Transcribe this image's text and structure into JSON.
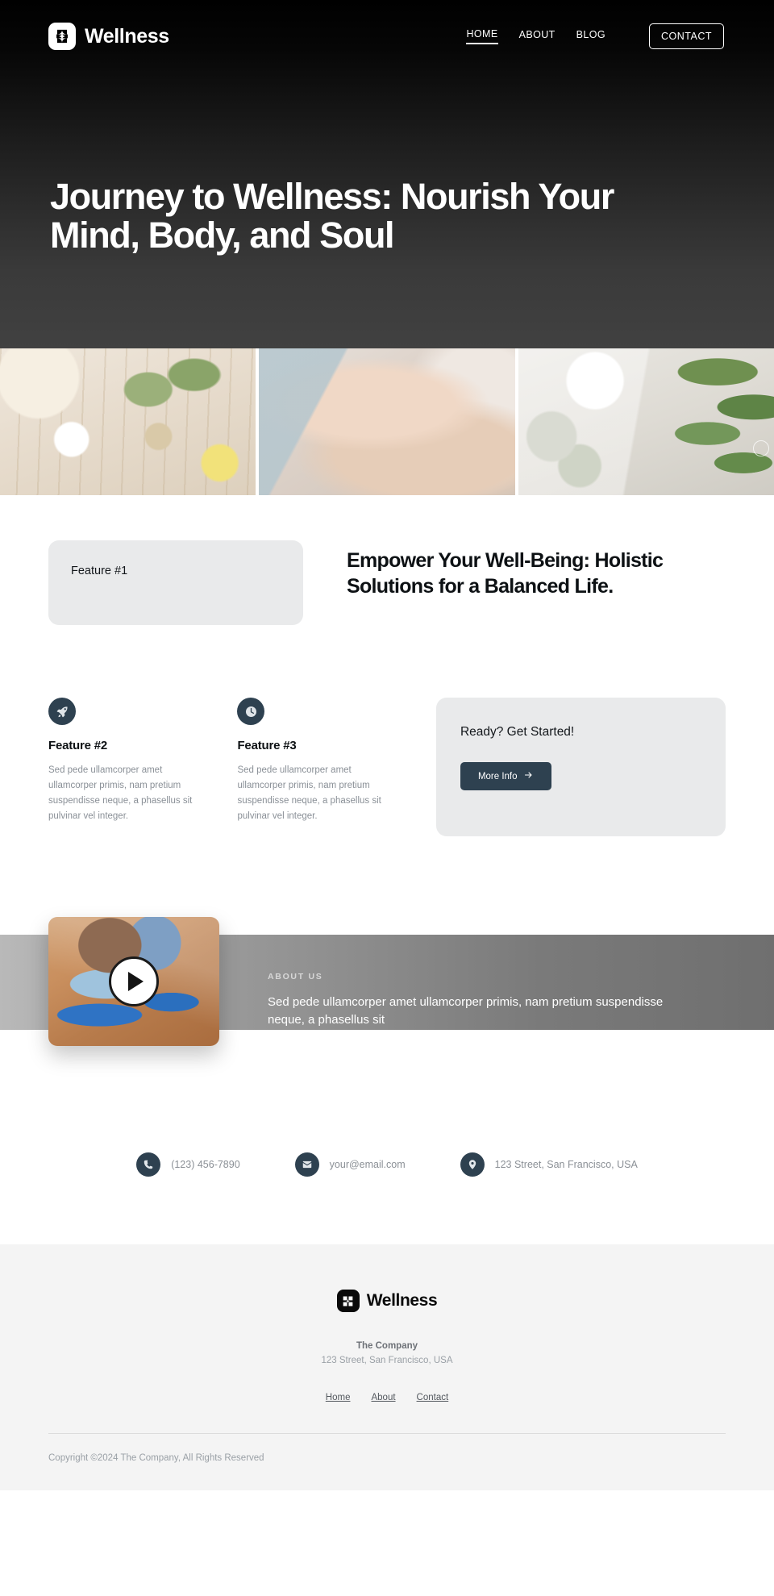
{
  "brand": {
    "name": "Wellness",
    "mark_icon": "wellness-petal-logo"
  },
  "nav": {
    "links": [
      {
        "label": "HOME",
        "active": true
      },
      {
        "label": "ABOUT",
        "active": false
      },
      {
        "label": "BLOG",
        "active": false
      }
    ],
    "cta_label": "CONTACT"
  },
  "hero": {
    "title": "Journey to Wellness: Nourish Your Mind, Body, and Soul"
  },
  "strip": {
    "images": [
      {
        "alt": "spa-flatlay-herbs-salt-bowl"
      },
      {
        "alt": "massage-therapy-hands"
      },
      {
        "alt": "coffee-macarons-leaves-enjoy-the-little-things"
      }
    ]
  },
  "features": {
    "card_title": "Feature #1",
    "section_heading": "Empower Your Well-Being: Holistic Solutions for a Balanced Life.",
    "items": [
      {
        "icon": "rocket-icon",
        "title": "Feature #2",
        "body": "Sed pede ullamcorper amet ullamcorper primis, nam pretium suspendisse neque, a phasellus sit pulvinar vel integer."
      },
      {
        "icon": "clock-icon",
        "title": "Feature #3",
        "body": "Sed pede ullamcorper amet ullamcorper primis, nam pretium suspendisse neque, a phasellus sit pulvinar vel integer."
      }
    ],
    "cta": {
      "title": "Ready? Get Started!",
      "button_label": "More Info",
      "button_icon": "arrow-right-icon"
    }
  },
  "about": {
    "eyebrow": "ABOUT US",
    "text": "Sed pede ullamcorper amet ullamcorper primis, nam pretium suspendisse neque, a phasellus sit",
    "video_alt": "couple-stretching-on-yoga-mats",
    "play_icon": "play-icon"
  },
  "contact": {
    "items": [
      {
        "icon": "phone-icon",
        "text": "(123) 456-7890"
      },
      {
        "icon": "envelope-icon",
        "text": "your@email.com"
      },
      {
        "icon": "location-pin-icon",
        "text": "123 Street, San Francisco, USA"
      }
    ]
  },
  "footer": {
    "brand_name": "Wellness",
    "company": "The Company",
    "address": "123 Street, San Francisco, USA",
    "links": [
      {
        "label": "Home"
      },
      {
        "label": "About"
      },
      {
        "label": "Contact"
      }
    ],
    "copyright": "Copyright ©2024 The Company, All Rights Reserved"
  },
  "colors": {
    "hero_bg_top": "#000000",
    "hero_bg_bottom": "#414141",
    "accent_slate": "#2e4150",
    "card_gray": "#e9eaeb",
    "footer_bg": "#f4f4f4",
    "muted_text": "#8a9097"
  }
}
